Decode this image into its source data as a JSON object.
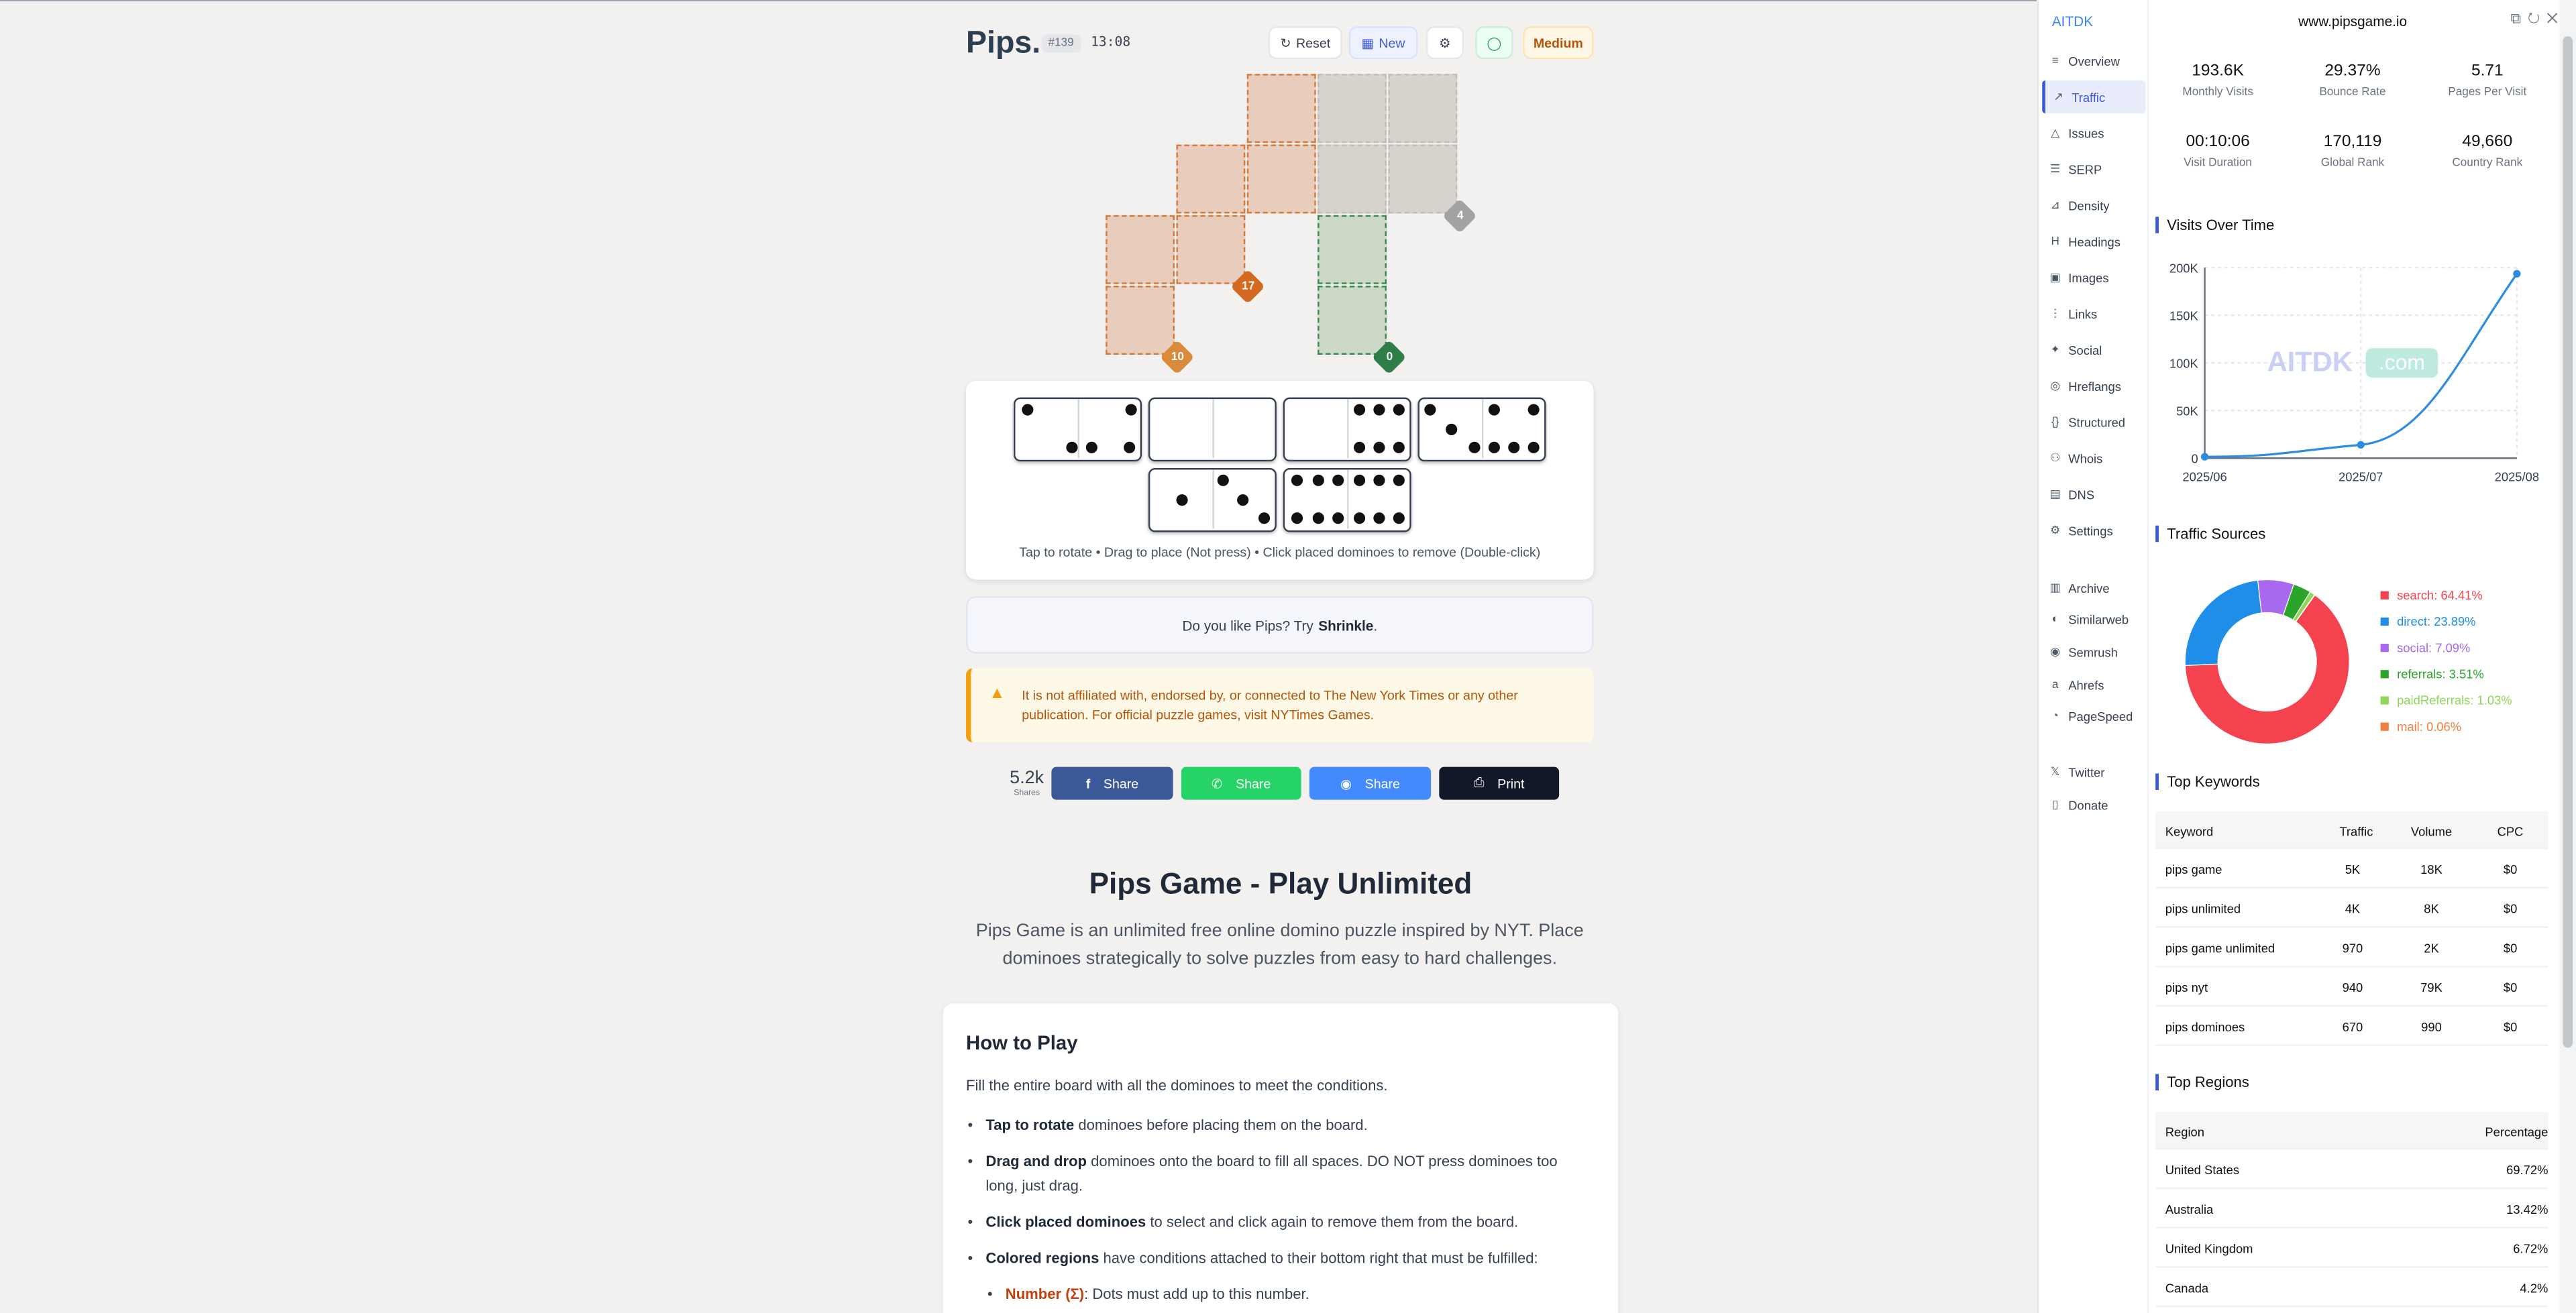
{
  "game": {
    "title": "Pips.",
    "puzzle_id": "#139",
    "timer": "13:08",
    "buttons": {
      "reset": "Reset",
      "new": "New",
      "difficulty": "Medium"
    },
    "badges": {
      "orange_a": "17",
      "orange_b": "10",
      "grey": "4",
      "green": "0"
    },
    "tray_hint": "Tap to rotate • Drag to place (Not press) • Click placed dominoes to remove (Double-click)",
    "promo_text": "Do you like Pips? Try",
    "promo_link": "Shrinkle",
    "promo_end": ".",
    "warning": "It is not affiliated with, endorsed by, or connected to The New York Times or any other publication. For official puzzle games, visit NYTimes Games.",
    "share_count": "5.2k",
    "share_label": "Shares",
    "share_buttons": {
      "facebook": "Share",
      "whatsapp": "Share",
      "messenger": "Share",
      "print": "Print"
    },
    "colors": {
      "facebook": "#3b5998",
      "whatsapp": "#25d366",
      "messenger": "#448aff",
      "print": "#111827"
    }
  },
  "article": {
    "heading": "Pips Game - Play Unlimited",
    "lead": "Pips Game is an unlimited free online domino puzzle inspired by NYT. Place dominoes strategically to solve puzzles from easy to hard challenges.",
    "how_title": "How to Play",
    "how_intro": "Fill the entire board with all the dominoes to meet the conditions.",
    "rules": [
      {
        "bold": "Tap to rotate",
        "text": " dominoes before placing them on the board."
      },
      {
        "bold": "Drag and drop",
        "text": " dominoes onto the board to fill all spaces. DO NOT press dominoes too long, just drag."
      },
      {
        "bold": "Click placed dominoes",
        "text": " to select and click again to remove them from the board."
      },
      {
        "bold": "Colored regions",
        "text": " have conditions attached to their bottom right that must be fulfilled:"
      }
    ],
    "sub_rule": {
      "bold": "Number (Σ)",
      "text": ": Dots must add up to this number."
    }
  },
  "ext": {
    "brand": "AITDK",
    "domain": "www.pipsgame.io",
    "nav": [
      {
        "label": "Overview",
        "icon": "≡"
      },
      {
        "label": "Traffic",
        "icon": "↗"
      },
      {
        "label": "Issues",
        "icon": "△"
      },
      {
        "label": "SERP",
        "icon": "☰"
      },
      {
        "label": "Density",
        "icon": "⊿"
      },
      {
        "label": "Headings",
        "icon": "H"
      },
      {
        "label": "Images",
        "icon": "▣"
      },
      {
        "label": "Links",
        "icon": "⋮"
      },
      {
        "label": "Social",
        "icon": "✦"
      },
      {
        "label": "Hreflangs",
        "icon": "◎"
      },
      {
        "label": "Structured",
        "icon": "{}"
      },
      {
        "label": "Whois",
        "icon": "⚇"
      },
      {
        "label": "DNS",
        "icon": "▤"
      },
      {
        "label": "Settings",
        "icon": "⚙"
      }
    ],
    "nav2": [
      {
        "label": "Archive",
        "icon": "▥"
      },
      {
        "label": "Similarweb",
        "icon": "◐"
      },
      {
        "label": "Semrush",
        "icon": "◉"
      },
      {
        "label": "Ahrefs",
        "icon": "a"
      },
      {
        "label": "PageSpeed",
        "icon": "◔"
      }
    ],
    "nav3": [
      {
        "label": "Twitter",
        "icon": "𝕏"
      },
      {
        "label": "Donate",
        "icon": "▯"
      }
    ],
    "stats": [
      {
        "value": "193.6K",
        "label": "Monthly Visits"
      },
      {
        "value": "29.37%",
        "label": "Bounce Rate"
      },
      {
        "value": "5.71",
        "label": "Pages Per Visit"
      },
      {
        "value": "00:10:06",
        "label": "Visit Duration"
      },
      {
        "value": "170,119",
        "label": "Global Rank"
      },
      {
        "value": "49,660",
        "label": "Country Rank"
      }
    ],
    "visits_title": "Visits Over Time",
    "watermark": "AITDK",
    "watermark_tld": ".com",
    "sources_title": "Traffic Sources",
    "keywords_title": "Top Keywords",
    "keywords_headers": [
      "Keyword",
      "Traffic",
      "Volume",
      "CPC"
    ],
    "keywords": [
      [
        "pips game",
        "5K",
        "18K",
        "$0"
      ],
      [
        "pips unlimited",
        "4K",
        "8K",
        "$0"
      ],
      [
        "pips game unlimited",
        "970",
        "2K",
        "$0"
      ],
      [
        "pips nyt",
        "940",
        "79K",
        "$0"
      ],
      [
        "pips dominoes",
        "670",
        "990",
        "$0"
      ]
    ],
    "regions_title": "Top Regions",
    "regions_headers": [
      "Region",
      "Percentage"
    ],
    "regions": [
      [
        "United States",
        "69.72%"
      ],
      [
        "Australia",
        "13.42%"
      ],
      [
        "United Kingdom",
        "6.72%"
      ],
      [
        "Canada",
        "4.2%"
      ]
    ]
  },
  "chart_data": [
    {
      "type": "line",
      "title": "Visits Over Time",
      "x": [
        "2025/06",
        "2025/07",
        "2025/08"
      ],
      "series": [
        {
          "values": [
            1500,
            14000,
            193600
          ]
        }
      ],
      "ylim": [
        0,
        200000
      ],
      "yticks": [
        "0",
        "50K",
        "100K",
        "150K",
        "200K"
      ],
      "color": "#2d8ce0",
      "grid": true
    },
    {
      "type": "pie",
      "title": "Traffic Sources",
      "labels": [
        "search: 64.41%",
        "direct: 23.89%",
        "social: 7.09%",
        "referrals: 3.51%",
        "paidReferrals: 1.03%",
        "mail: 0.06%"
      ],
      "values": [
        64.41,
        23.89,
        7.09,
        3.51,
        1.03,
        0.06
      ],
      "colors": [
        "#f5424f",
        "#1f8ee8",
        "#a868f0",
        "#2aa52a",
        "#8fd65a",
        "#f07e3c"
      ],
      "legend": "right"
    }
  ]
}
